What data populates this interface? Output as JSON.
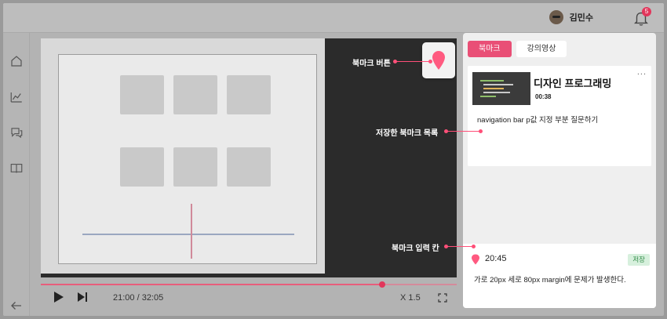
{
  "header": {
    "username": "김민수",
    "notification_count": "5"
  },
  "callouts": {
    "bookmark_button": "북마크 버튼",
    "saved_list": "저장한 북마크 목록",
    "input_area": "북마크 입력 칸"
  },
  "panel": {
    "tabs": [
      {
        "label": "북마크"
      },
      {
        "label": "강의영상"
      }
    ],
    "card": {
      "title": "디자인 프로그래밍",
      "time": "00:38",
      "note": "navigation bar p값 지정 부분 질문하기",
      "more": "..."
    },
    "entry": {
      "time": "20:45",
      "save_label": "저장",
      "text": "가로 20px 세로 80px  margin에 문제가 발생한다."
    }
  },
  "player": {
    "time_label": "21:00 / 32:05",
    "speed_label": "X 1.5",
    "progress": 0.82
  },
  "icons": [
    "home-icon",
    "chart-icon",
    "chat-icon",
    "book-icon",
    "back-arrow-icon",
    "bell-icon",
    "play-icon",
    "skip-next-icon",
    "fullscreen-icon",
    "pin-icon",
    "more-icon"
  ],
  "colors": {
    "accent": "#e94f76",
    "save_bg": "#d7f0dd",
    "save_text": "#2f8a46"
  }
}
